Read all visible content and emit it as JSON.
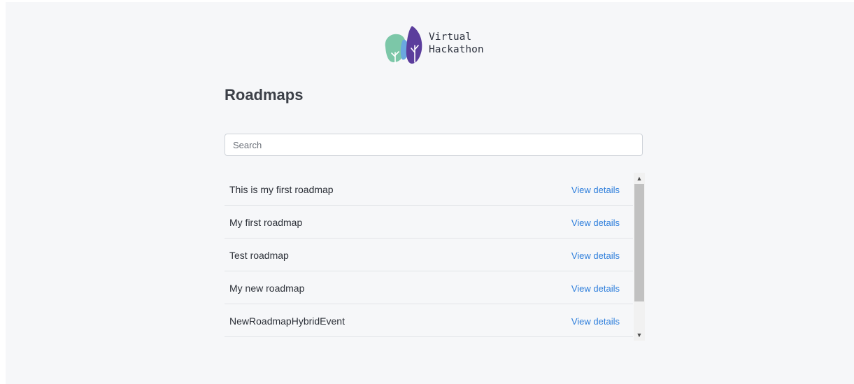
{
  "brand": {
    "line1": "Virtual",
    "line2": "Hackathon",
    "logo_colors": [
      "#7cc7a8",
      "#5b3d9c",
      "#6aa8e0"
    ]
  },
  "page_title": "Roadmaps",
  "search": {
    "placeholder": "Search",
    "value": ""
  },
  "roadmaps": [
    {
      "name": "This is my first roadmap",
      "action": "View details"
    },
    {
      "name": "My first roadmap",
      "action": "View details"
    },
    {
      "name": "Test roadmap",
      "action": "View details"
    },
    {
      "name": "My new roadmap",
      "action": "View details"
    },
    {
      "name": "NewRoadmapHybridEvent",
      "action": "View details"
    }
  ],
  "icons": {
    "scroll_up": "chevron-up-icon",
    "scroll_down": "chevron-down-icon",
    "logo": "tree-logo-icon"
  },
  "colors": {
    "background": "#f6f7f9",
    "link": "#2f7fdc",
    "title": "#3b3f47"
  }
}
